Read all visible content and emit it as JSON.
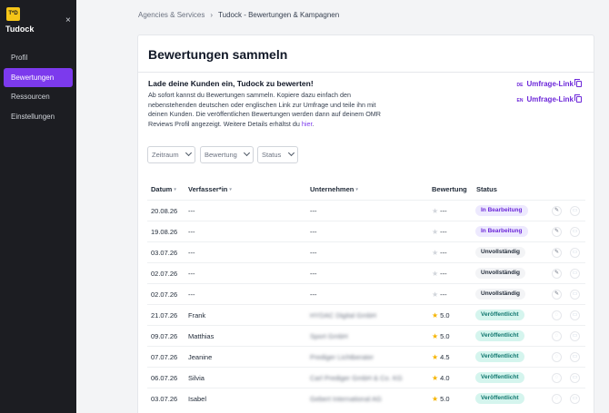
{
  "sidebar": {
    "logo_text": "T*D",
    "brand": "Tudock",
    "close": "×",
    "items": [
      {
        "label": "Profil",
        "active": false
      },
      {
        "label": "Bewertungen",
        "active": true
      },
      {
        "label": "Ressourcen",
        "active": false
      },
      {
        "label": "Einstellungen",
        "active": false
      }
    ]
  },
  "breadcrumb": {
    "parent": "Agencies & Services",
    "separator": "›",
    "current": "Tudock - Bewertungen & Kampagnen"
  },
  "card": {
    "title": "Bewertungen sammeln",
    "intro_heading": "Lade deine Kunden ein, Tudock zu bewerten!",
    "intro_text": "Ab sofort kannst du Bewertungen sammeln. Kopiere dazu einfach den nebenstehenden deutschen oder englischen Link zur Umfrage und teile ihn mit deinen Kunden. Die veröffentlichen Bewertungen werden dann auf deinem OMR Reviews Profil angezeigt. Weitere Details erhältst du",
    "intro_link": "hier",
    "intro_end": ".",
    "survey_links": [
      {
        "flag": "DE",
        "label": "Umfrage-Link"
      },
      {
        "flag": "EN",
        "label": "Umfrage-Link"
      }
    ]
  },
  "filters": [
    "Zeitraum",
    "Bewertung",
    "Status"
  ],
  "table": {
    "headers": {
      "date": "Datum",
      "author": "Verfasser*in",
      "company": "Unternehmen",
      "rating": "Bewertung",
      "status": "Status"
    },
    "rows": [
      {
        "date": "20.08.26",
        "author": "---",
        "company": "---",
        "company_blurred": false,
        "rating": "---",
        "rated": false,
        "status": "In Bearbeitung",
        "status_type": "purple",
        "editable": true
      },
      {
        "date": "19.08.26",
        "author": "---",
        "company": "---",
        "company_blurred": false,
        "rating": "---",
        "rated": false,
        "status": "In Bearbeitung",
        "status_type": "purple",
        "editable": true
      },
      {
        "date": "03.07.26",
        "author": "---",
        "company": "---",
        "company_blurred": false,
        "rating": "---",
        "rated": false,
        "status": "Unvollständig",
        "status_type": "gray",
        "editable": true
      },
      {
        "date": "02.07.26",
        "author": "---",
        "company": "---",
        "company_blurred": false,
        "rating": "---",
        "rated": false,
        "status": "Unvollständig",
        "status_type": "gray",
        "editable": true
      },
      {
        "date": "02.07.26",
        "author": "---",
        "company": "---",
        "company_blurred": false,
        "rating": "---",
        "rated": false,
        "status": "Unvollständig",
        "status_type": "gray",
        "editable": true
      },
      {
        "date": "21.07.26",
        "author": "Frank",
        "company": "HYDAC Digital GmbH",
        "company_blurred": true,
        "rating": "5.0",
        "rated": true,
        "status": "Veröffentlicht",
        "status_type": "teal",
        "editable": false
      },
      {
        "date": "09.07.26",
        "author": "Matthias",
        "company": "Sport GmbH",
        "company_blurred": true,
        "rating": "5.0",
        "rated": true,
        "status": "Veröffentlicht",
        "status_type": "teal",
        "editable": false
      },
      {
        "date": "07.07.26",
        "author": "Jeanine",
        "company": "Prediger Lichtberater",
        "company_blurred": true,
        "rating": "4.5",
        "rated": true,
        "status": "Veröffentlicht",
        "status_type": "teal",
        "editable": false
      },
      {
        "date": "06.07.26",
        "author": "Silvia",
        "company": "Carl Prediger GmbH & Co. KG",
        "company_blurred": true,
        "rating": "4.0",
        "rated": true,
        "status": "Veröffentlicht",
        "status_type": "teal",
        "editable": false
      },
      {
        "date": "03.07.26",
        "author": "Isabel",
        "company": "Gebert International AG",
        "company_blurred": true,
        "rating": "5.0",
        "rated": true,
        "status": "Veröffentlicht",
        "status_type": "teal",
        "editable": false
      }
    ]
  }
}
